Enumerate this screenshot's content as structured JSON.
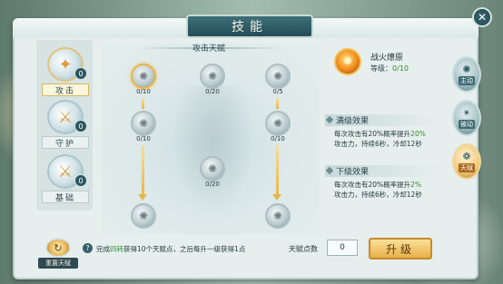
{
  "window": {
    "title": "技能",
    "close": "✕"
  },
  "categories": [
    {
      "label": "攻击",
      "badge": "0",
      "icon": "attack-talent-icon"
    },
    {
      "label": "守护",
      "badge": "0",
      "icon": "guard-talent-icon"
    },
    {
      "label": "基础",
      "badge": "0",
      "icon": "basic-talent-icon"
    }
  ],
  "tree": {
    "title": "攻击天赋",
    "nodes": [
      {
        "count": "0/10"
      },
      {
        "count": "0/20"
      },
      {
        "count": "0/5"
      },
      {
        "count": "0/10"
      },
      {
        "count": "0/10"
      },
      {
        "count": "0/20"
      }
    ]
  },
  "skill": {
    "name": "战火燎原",
    "level_label": "等级：",
    "level_value": "0/10",
    "max_head": "满级效果",
    "max_text_a": "每次攻击有20%概率提升",
    "max_text_b": "20%",
    "max_text_c": "攻击力，持续6秒，冷却12秒",
    "next_head": "下级效果",
    "next_text_a": "每次攻击有20%概率提升",
    "next_text_b": "2%",
    "next_text_c": "攻击力，持续6秒，冷却12秒"
  },
  "side_tabs": [
    {
      "label": "主动",
      "icon": "active-skill-icon"
    },
    {
      "label": "被动",
      "icon": "passive-skill-icon"
    },
    {
      "label": "天赋",
      "icon": "talent-icon"
    }
  ],
  "bottom": {
    "reset_label": "重置天赋",
    "hint_a": "完成",
    "hint_b": "四转",
    "hint_c": "获得10个天赋点，之后每升一级获得1点",
    "points_label": "天赋点数",
    "points_value": "0",
    "upgrade_label": "升级"
  },
  "colors": {
    "accent": "#e8b04a",
    "highlight": "#2f8e2a"
  }
}
